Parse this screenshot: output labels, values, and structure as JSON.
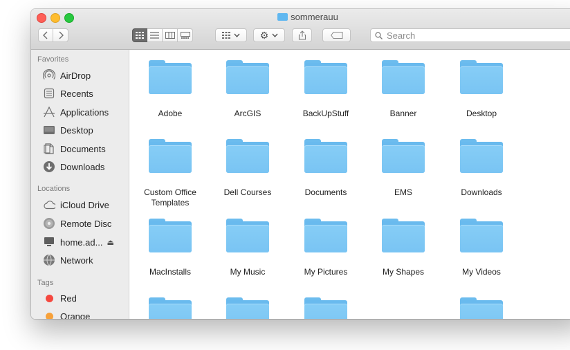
{
  "window": {
    "title": "sommerauu"
  },
  "toolbar": {
    "search_placeholder": "Search",
    "view_modes": [
      "icon-view",
      "list-view",
      "column-view",
      "gallery-view"
    ]
  },
  "sidebar": {
    "favorites_label": "Favorites",
    "favorites": [
      {
        "label": "AirDrop",
        "icon": "airdrop-icon"
      },
      {
        "label": "Recents",
        "icon": "recents-icon"
      },
      {
        "label": "Applications",
        "icon": "applications-icon"
      },
      {
        "label": "Desktop",
        "icon": "desktop-icon"
      },
      {
        "label": "Documents",
        "icon": "documents-icon"
      },
      {
        "label": "Downloads",
        "icon": "downloads-icon"
      }
    ],
    "locations_label": "Locations",
    "locations": [
      {
        "label": "iCloud Drive",
        "icon": "icloud-icon"
      },
      {
        "label": "Remote Disc",
        "icon": "disc-icon"
      },
      {
        "label": "home.ad...",
        "icon": "computer-icon"
      },
      {
        "label": "Network",
        "icon": "network-icon"
      }
    ],
    "tags_label": "Tags",
    "tags": [
      {
        "label": "Red",
        "color": "#f5483f"
      },
      {
        "label": "Orange",
        "color": "#f7a13a"
      }
    ]
  },
  "files": [
    "Adobe",
    "ArcGIS",
    "BackUpStuff",
    "Banner",
    "Desktop",
    "Custom Office Templates",
    "Dell Courses",
    "Documents",
    "EMS",
    "Downloads",
    "MacInstalls",
    "My Music",
    "My Pictures",
    "My Shapes",
    "My Videos",
    "",
    "",
    "",
    "",
    ""
  ],
  "colors": {
    "folder": "#79c4f3",
    "selected_view": "#6d6d6d"
  }
}
